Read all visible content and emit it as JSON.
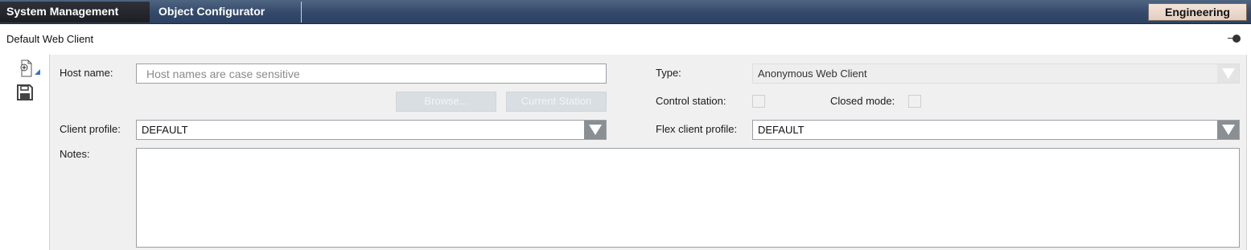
{
  "header": {
    "tabs": [
      {
        "label": "System Management",
        "active": true
      },
      {
        "label": "Object Configurator",
        "active": false
      }
    ],
    "mode_button": "Engineering"
  },
  "page": {
    "title": "Default Web Client"
  },
  "toolbar": {
    "icons": [
      "new-object-icon",
      "save-icon"
    ]
  },
  "form": {
    "host_name": {
      "label": "Host name:",
      "value": "",
      "placeholder": "Host names are case sensitive"
    },
    "browse_label": "Browse...",
    "current_station_label": "Current Station",
    "client_profile": {
      "label": "Client profile:",
      "value": "DEFAULT"
    },
    "notes": {
      "label": "Notes:",
      "value": ""
    },
    "type": {
      "label": "Type:",
      "value": "Anonymous Web Client"
    },
    "control_station": {
      "label": "Control station:",
      "checked": false
    },
    "closed_mode": {
      "label": "Closed mode:",
      "checked": false
    },
    "flex_client_profile": {
      "label": "Flex client profile:",
      "value": "DEFAULT"
    }
  },
  "colors": {
    "header_bg": "#34496a",
    "active_tab_bg": "#1c1e22",
    "engineering_bg": "#ead7cc",
    "dropdown_arrow_bg": "#8a8f94",
    "disabled_button_bg": "#d9dee3"
  }
}
